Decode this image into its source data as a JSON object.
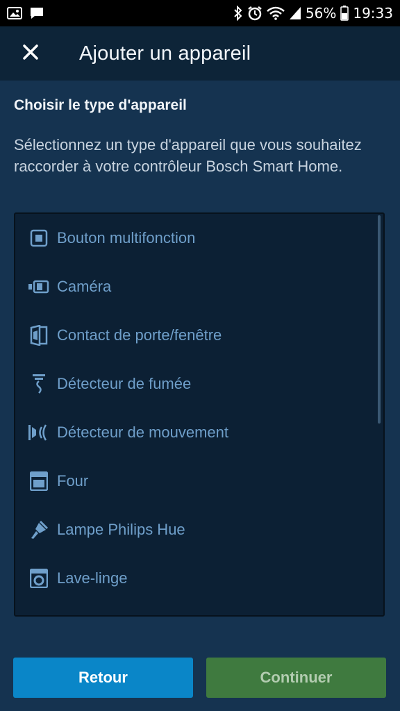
{
  "status_bar": {
    "battery": "56%",
    "time": "19:33",
    "icons": [
      "image-notification-icon",
      "message-notification-icon",
      "bluetooth-icon",
      "alarm-icon",
      "wifi-icon",
      "signal-icon",
      "battery-icon"
    ]
  },
  "header": {
    "title": "Ajouter un appareil",
    "close_icon": "close-icon"
  },
  "content": {
    "section_title": "Choisir le type d'appareil",
    "description": "Sélectionnez un type d'appareil que vous souhaitez raccorder à votre contrôleur Bosch Smart Home."
  },
  "device_list": [
    {
      "label": "Bouton multifonction",
      "icon": "button-icon"
    },
    {
      "label": "Caméra",
      "icon": "camera-icon"
    },
    {
      "label": "Contact de porte/fenêtre",
      "icon": "door-contact-icon"
    },
    {
      "label": "Détecteur de fumée",
      "icon": "smoke-detector-icon"
    },
    {
      "label": "Détecteur de mouvement",
      "icon": "motion-detector-icon"
    },
    {
      "label": "Four",
      "icon": "oven-icon"
    },
    {
      "label": "Lampe Philips Hue",
      "icon": "lamp-icon"
    },
    {
      "label": "Lave-linge",
      "icon": "washing-machine-icon"
    }
  ],
  "buttons": {
    "back": "Retour",
    "continue": "Continuer"
  },
  "colors": {
    "background": "#153350",
    "appbar": "#0d2438",
    "list_text": "#6f9fca",
    "back_button": "#0a86c8",
    "continue_button": "#3f7a3f"
  }
}
